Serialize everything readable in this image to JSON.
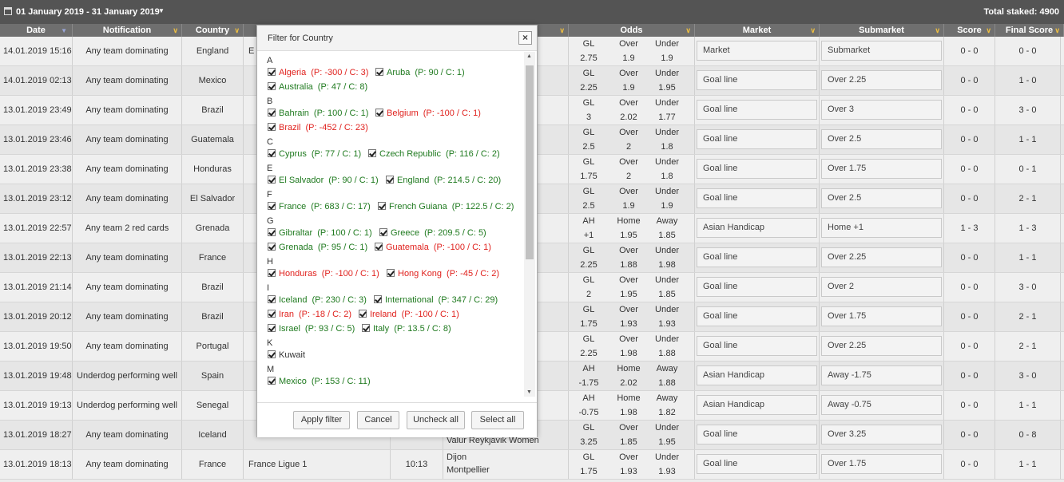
{
  "topbar": {
    "date_range": "01 January 2019 - 31 January 2019",
    "total_staked": "Total staked: 4900"
  },
  "columns": {
    "date": "Date",
    "notification": "Notification",
    "country": "Country",
    "odds": "Odds",
    "market": "Market",
    "submarket": "Submarket",
    "score": "Score",
    "final_score": "Final Score"
  },
  "rows": [
    {
      "date": "14.01.2019 15:16",
      "notification": "Any team dominating",
      "country": "England",
      "league": "E",
      "time": "",
      "team1": "",
      "team2": "",
      "odds_h": [
        "GL",
        "Over",
        "Under"
      ],
      "odds_v": [
        "2.75",
        "1.9",
        "1.9"
      ],
      "market": "Market",
      "submarket": "Submarket",
      "score": "0 - 0",
      "final": "0 - 0"
    },
    {
      "date": "14.01.2019 02:13",
      "notification": "Any team dominating",
      "country": "Mexico",
      "league": "",
      "time": "",
      "team1": "",
      "team2": "",
      "odds_h": [
        "GL",
        "Over",
        "Under"
      ],
      "odds_v": [
        "2.25",
        "1.9",
        "1.95"
      ],
      "market": "Goal line",
      "submarket": "Over 2.25",
      "score": "0 - 0",
      "final": "1 - 0"
    },
    {
      "date": "13.01.2019 23:49",
      "notification": "Any team dominating",
      "country": "Brazil",
      "league": "",
      "time": "",
      "team1": "",
      "team2": "",
      "odds_h": [
        "GL",
        "Over",
        "Under"
      ],
      "odds_v": [
        "3",
        "2.02",
        "1.77"
      ],
      "market": "Goal line",
      "submarket": "Over 3",
      "score": "0 - 0",
      "final": "3 - 0"
    },
    {
      "date": "13.01.2019 23:46",
      "notification": "Any team dominating",
      "country": "Guatemala",
      "league": "",
      "time": "",
      "team1": "",
      "team2": "los",
      "odds_h": [
        "GL",
        "Over",
        "Under"
      ],
      "odds_v": [
        "2.5",
        "2",
        "1.8"
      ],
      "market": "Goal line",
      "submarket": "Over 2.5",
      "score": "0 - 0",
      "final": "1 - 1"
    },
    {
      "date": "13.01.2019 23:38",
      "notification": "Any team dominating",
      "country": "Honduras",
      "league": "",
      "time": "",
      "team1": "",
      "team2": "",
      "odds_h": [
        "GL",
        "Over",
        "Under"
      ],
      "odds_v": [
        "1.75",
        "2",
        "1.8"
      ],
      "market": "Goal line",
      "submarket": "Over 1.75",
      "score": "0 - 0",
      "final": "0 - 1"
    },
    {
      "date": "13.01.2019 23:12",
      "notification": "Any team dominating",
      "country": "El Salvador",
      "league": "",
      "time": "",
      "team1": "",
      "team2": "",
      "odds_h": [
        "GL",
        "Over",
        "Under"
      ],
      "odds_v": [
        "2.5",
        "1.9",
        "1.9"
      ],
      "market": "Goal line",
      "submarket": "Over 2.5",
      "score": "0 - 0",
      "final": "2 - 1"
    },
    {
      "date": "13.01.2019 22:57",
      "notification": "Any team 2 red cards",
      "country": "Grenada",
      "league": "",
      "time": "",
      "team1": "G...",
      "team2": "",
      "odds_h": [
        "AH",
        "Home",
        "Away"
      ],
      "odds_v": [
        "+1",
        "1.95",
        "1.85"
      ],
      "market": "Asian Handicap",
      "submarket": "Home +1",
      "score": "1 - 3",
      "final": "1 - 3"
    },
    {
      "date": "13.01.2019 22:13",
      "notification": "Any team dominating",
      "country": "France",
      "league": "",
      "time": "",
      "team1": "",
      "team2": "",
      "odds_h": [
        "GL",
        "Over",
        "Under"
      ],
      "odds_v": [
        "2.25",
        "1.88",
        "1.98"
      ],
      "market": "Goal line",
      "submarket": "Over 2.25",
      "score": "0 - 0",
      "final": "1 - 1"
    },
    {
      "date": "13.01.2019 21:14",
      "notification": "Any team dominating",
      "country": "Brazil",
      "league": "",
      "time": "",
      "team1": "",
      "team2": "",
      "odds_h": [
        "GL",
        "Over",
        "Under"
      ],
      "odds_v": [
        "2",
        "1.95",
        "1.85"
      ],
      "market": "Goal line",
      "submarket": "Over 2",
      "score": "0 - 0",
      "final": "3 - 0"
    },
    {
      "date": "13.01.2019 20:12",
      "notification": "Any team dominating",
      "country": "Brazil",
      "league": "",
      "time": "",
      "team1": "",
      "team2": "",
      "odds_h": [
        "GL",
        "Over",
        "Under"
      ],
      "odds_v": [
        "1.75",
        "1.93",
        "1.93"
      ],
      "market": "Goal line",
      "submarket": "Over 1.75",
      "score": "0 - 0",
      "final": "2 - 1"
    },
    {
      "date": "13.01.2019 19:50",
      "notification": "Any team dominating",
      "country": "Portugal",
      "league": "",
      "time": "",
      "team1": "",
      "team2": "",
      "odds_h": [
        "GL",
        "Over",
        "Under"
      ],
      "odds_v": [
        "2.25",
        "1.98",
        "1.88"
      ],
      "market": "Goal line",
      "submarket": "Over 2.25",
      "score": "0 - 0",
      "final": "2 - 1"
    },
    {
      "date": "13.01.2019 19:48",
      "notification": "Underdog performing well",
      "country": "Spain",
      "league": "",
      "time": "",
      "team1": "",
      "team2": "",
      "odds_h": [
        "AH",
        "Home",
        "Away"
      ],
      "odds_v": [
        "-1.75",
        "2.02",
        "1.88"
      ],
      "market": "Asian Handicap",
      "submarket": "Away -1.75",
      "score": "0 - 0",
      "final": "3 - 0"
    },
    {
      "date": "13.01.2019 19:13",
      "notification": "Underdog performing well",
      "country": "Senegal",
      "league": "",
      "time": "",
      "team1": "",
      "team2": "",
      "odds_h": [
        "AH",
        "Home",
        "Away"
      ],
      "odds_v": [
        "-0.75",
        "1.98",
        "1.82"
      ],
      "market": "Asian Handicap",
      "submarket": "Away -0.75",
      "score": "0 - 0",
      "final": "1 - 1"
    },
    {
      "date": "13.01.2019 18:27",
      "notification": "Any team dominating",
      "country": "Iceland",
      "league": "",
      "time": "",
      "team1": "",
      "team2": "Valur Reykjavik Women",
      "odds_h": [
        "GL",
        "Over",
        "Under"
      ],
      "odds_v": [
        "3.25",
        "1.85",
        "1.95"
      ],
      "market": "Goal line",
      "submarket": "Over 3.25",
      "score": "0 - 0",
      "final": "0 - 8"
    },
    {
      "date": "13.01.2019 18:13",
      "notification": "Any team dominating",
      "country": "France",
      "league": "France Ligue 1",
      "time": "10:13",
      "team1": "Dijon",
      "team2": "Montpellier",
      "odds_h": [
        "GL",
        "Over",
        "Under"
      ],
      "odds_v": [
        "1.75",
        "1.93",
        "1.93"
      ],
      "market": "Goal line",
      "submarket": "Over 1.75",
      "score": "0 - 0",
      "final": "1 - 1"
    }
  ],
  "modal": {
    "title": "Filter for Country",
    "sections": [
      {
        "letter": "A",
        "items": [
          {
            "name": "Algeria",
            "stats": "(P: -300 / C: 3)",
            "color": "red"
          },
          {
            "name": "Aruba",
            "stats": "(P: 90 / C: 1)",
            "color": "green"
          },
          {
            "name": "Australia",
            "stats": "(P: 47 / C: 8)",
            "color": "green"
          }
        ]
      },
      {
        "letter": "B",
        "items": [
          {
            "name": "Bahrain",
            "stats": "(P: 100 / C: 1)",
            "color": "green"
          },
          {
            "name": "Belgium",
            "stats": "(P: -100 / C: 1)",
            "color": "red"
          },
          {
            "name": "Brazil",
            "stats": "(P: -452 / C: 23)",
            "color": "red"
          }
        ]
      },
      {
        "letter": "C",
        "items": [
          {
            "name": "Cyprus",
            "stats": "(P: 77 / C: 1)",
            "color": "green"
          },
          {
            "name": "Czech Republic",
            "stats": "(P: 116 / C: 2)",
            "color": "green"
          }
        ]
      },
      {
        "letter": "E",
        "items": [
          {
            "name": "El Salvador",
            "stats": "(P: 90 / C: 1)",
            "color": "green"
          },
          {
            "name": "England",
            "stats": "(P: 214.5 / C: 20)",
            "color": "green"
          }
        ]
      },
      {
        "letter": "F",
        "items": [
          {
            "name": "France",
            "stats": "(P: 683 / C: 17)",
            "color": "green"
          },
          {
            "name": "French Guiana",
            "stats": "(P: 122.5 / C: 2)",
            "color": "green"
          }
        ]
      },
      {
        "letter": "G",
        "items": [
          {
            "name": "Gibraltar",
            "stats": "(P: 100 / C: 1)",
            "color": "green"
          },
          {
            "name": "Greece",
            "stats": "(P: 209.5 / C: 5)",
            "color": "green"
          },
          {
            "name": "Grenada",
            "stats": "(P: 95 / C: 1)",
            "color": "green"
          },
          {
            "name": "Guatemala",
            "stats": "(P: -100 / C: 1)",
            "color": "red"
          }
        ]
      },
      {
        "letter": "H",
        "items": [
          {
            "name": "Honduras",
            "stats": "(P: -100 / C: 1)",
            "color": "red"
          },
          {
            "name": "Hong Kong",
            "stats": "(P: -45 / C: 2)",
            "color": "red"
          }
        ]
      },
      {
        "letter": "I",
        "items": [
          {
            "name": "Iceland",
            "stats": "(P: 230 / C: 3)",
            "color": "green"
          },
          {
            "name": "International",
            "stats": "(P: 347 / C: 29)",
            "color": "green"
          },
          {
            "name": "Iran",
            "stats": "(P: -18 / C: 2)",
            "color": "red"
          },
          {
            "name": "Ireland",
            "stats": "(P: -100 / C: 1)",
            "color": "red"
          },
          {
            "name": "Israel",
            "stats": "(P: 93 / C: 5)",
            "color": "green"
          },
          {
            "name": "Italy",
            "stats": "(P: 13.5 / C: 8)",
            "color": "green"
          }
        ]
      },
      {
        "letter": "K",
        "items": [
          {
            "name": "Kuwait",
            "stats": "",
            "color": "dark"
          }
        ]
      },
      {
        "letter": "M",
        "items": [
          {
            "name": "Mexico",
            "stats": "(P: 153 / C: 11)",
            "color": "green"
          }
        ]
      }
    ],
    "buttons": {
      "apply": "Apply filter",
      "cancel": "Cancel",
      "uncheck": "Uncheck all",
      "select": "Select all"
    }
  },
  "colors": {
    "header_bg": "#6f6f6f",
    "topbar_bg": "#545454",
    "green": "#1f7a1f",
    "red": "#e0221e",
    "dropdown_arrow": "#f0c040"
  }
}
